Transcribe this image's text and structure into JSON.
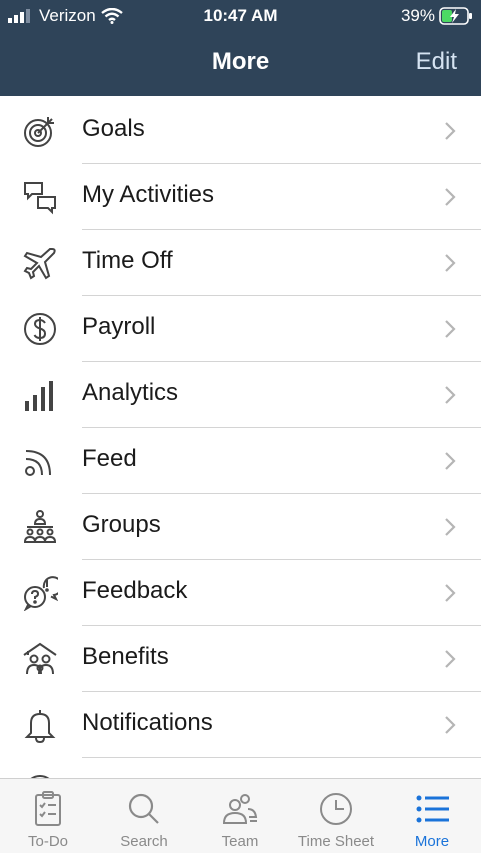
{
  "status_bar": {
    "carrier": "Verizon",
    "time": "10:47 AM",
    "battery": "39%"
  },
  "nav": {
    "title": "More",
    "edit_label": "Edit"
  },
  "menu": {
    "items": [
      {
        "label": "Goals",
        "icon": "target-icon"
      },
      {
        "label": "My Activities",
        "icon": "chat-bubbles-icon"
      },
      {
        "label": "Time Off",
        "icon": "airplane-icon"
      },
      {
        "label": "Payroll",
        "icon": "dollar-icon"
      },
      {
        "label": "Analytics",
        "icon": "bar-chart-icon"
      },
      {
        "label": "Feed",
        "icon": "rss-icon"
      },
      {
        "label": "Groups",
        "icon": "group-icon"
      },
      {
        "label": "Feedback",
        "icon": "feedback-icon"
      },
      {
        "label": "Benefits",
        "icon": "house-people-icon"
      },
      {
        "label": "Notifications",
        "icon": "bell-icon"
      }
    ]
  },
  "tabbar": {
    "tabs": [
      {
        "label": "To-Do",
        "icon": "clipboard-icon"
      },
      {
        "label": "Search",
        "icon": "search-icon"
      },
      {
        "label": "Team",
        "icon": "team-icon"
      },
      {
        "label": "Time Sheet",
        "icon": "clock-icon"
      },
      {
        "label": "More",
        "icon": "list-icon",
        "active": true
      }
    ]
  },
  "colors": {
    "header": "#2f4459",
    "active_tab": "#1a73d9",
    "divider": "#d4d4d4"
  }
}
